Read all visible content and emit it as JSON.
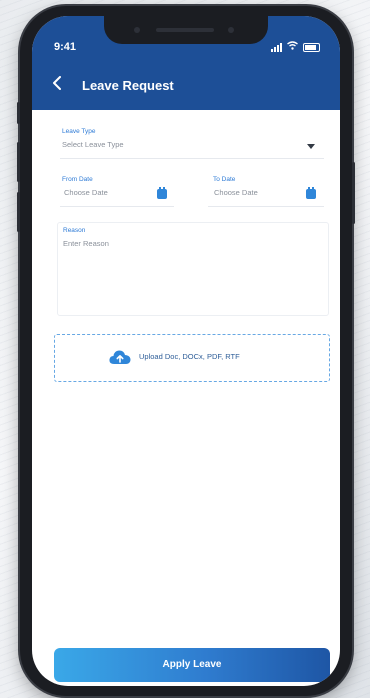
{
  "status_bar": {
    "time": "9:41"
  },
  "header": {
    "title": "Leave Request",
    "back_icon": "chevron-left-icon"
  },
  "form": {
    "leave_type": {
      "label": "Leave Type",
      "placeholder": "Select Leave Type"
    },
    "from_date": {
      "label": "From Date",
      "placeholder": "Choose Date"
    },
    "to_date": {
      "label": "To Date",
      "placeholder": "Choose Date"
    },
    "reason": {
      "label": "Reason",
      "placeholder": "Enter Reason"
    },
    "upload": {
      "label": "Upload Doc, DOCx, PDF, RTF",
      "icon": "cloud-upload-icon"
    }
  },
  "apply_button": {
    "label": "Apply Leave"
  },
  "colors": {
    "header": "#1d4f97",
    "accent": "#2f86d9",
    "label": "#2e7bd6"
  }
}
